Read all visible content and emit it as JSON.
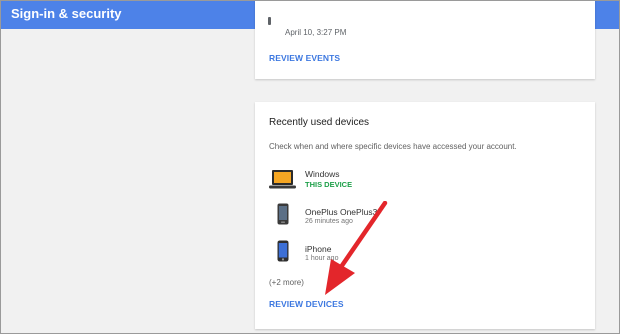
{
  "header": {
    "title": "Sign-in & security"
  },
  "events_card": {
    "date": "April 10, 3:27 PM",
    "review_label": "REVIEW EVENTS"
  },
  "devices_card": {
    "title": "Recently used devices",
    "description": "Check when and where specific devices have accessed your account.",
    "devices": [
      {
        "name": "Windows",
        "status": "THIS DEVICE",
        "icon": "laptop-icon"
      },
      {
        "name": "OnePlus OnePlus3",
        "time": "26 minutes ago",
        "icon": "android-phone-icon"
      },
      {
        "name": "iPhone",
        "time": "1 hour ago",
        "icon": "iphone-icon"
      }
    ],
    "more": "(+2 more)",
    "review_label": "REVIEW DEVICES"
  },
  "colors": {
    "header_bg": "#4d82e8",
    "link": "#3d78e0",
    "status_green": "#1ea04a",
    "arrow": "#e3262b"
  }
}
